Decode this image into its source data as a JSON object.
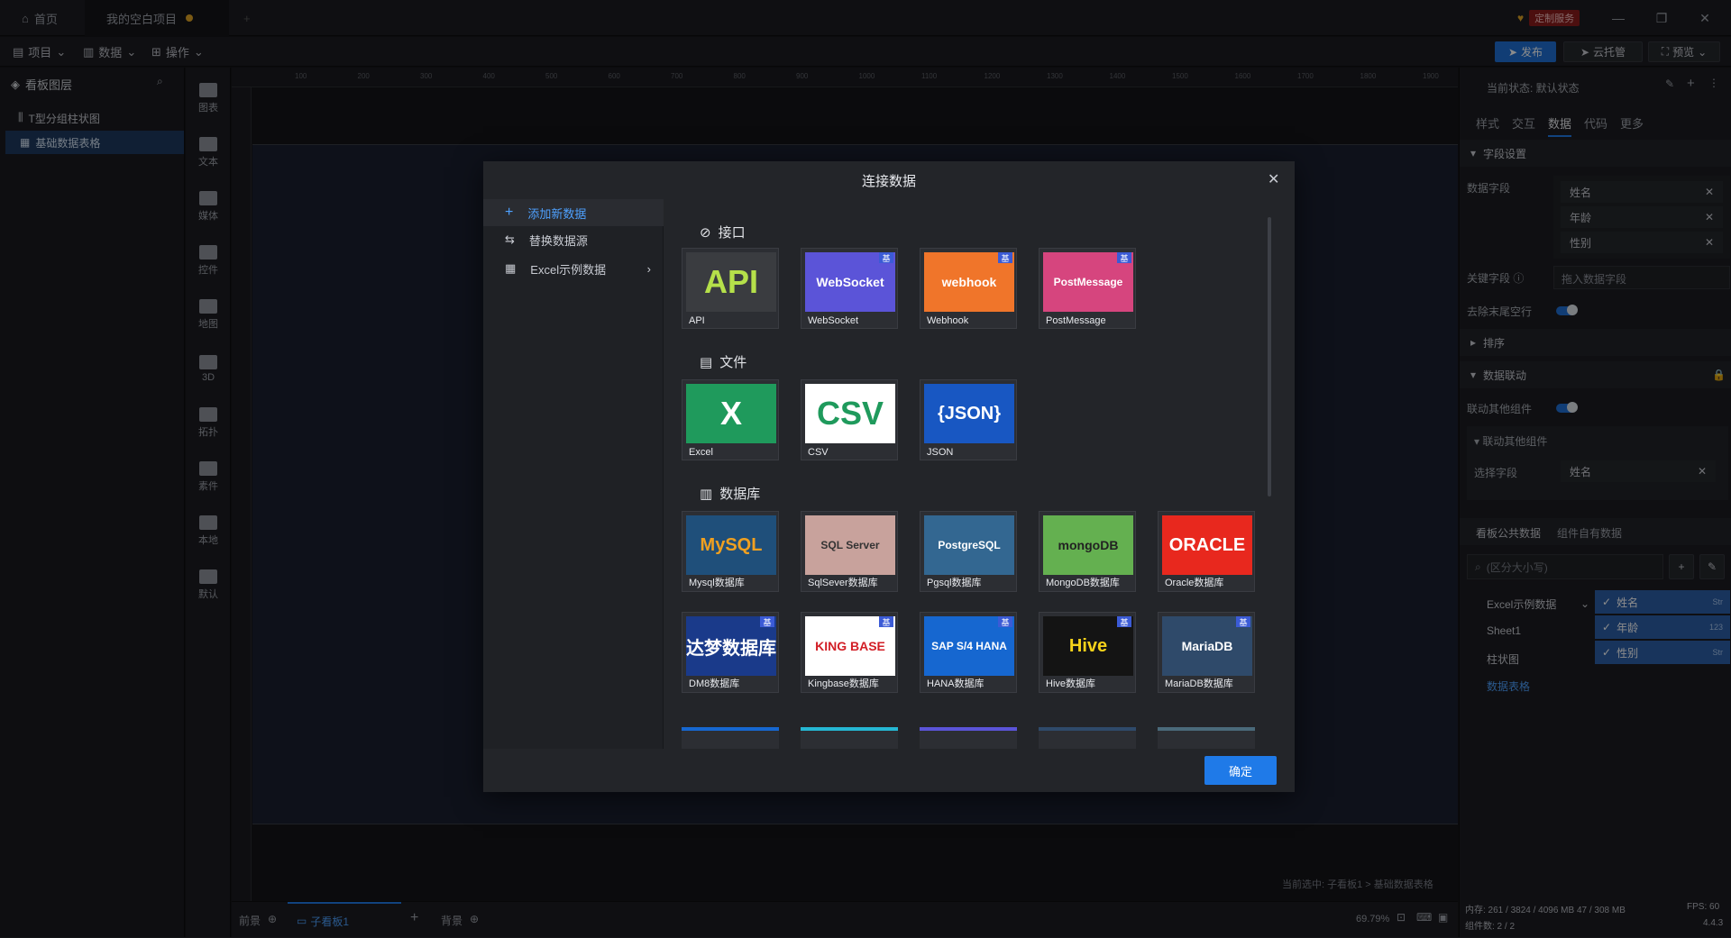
{
  "titlebar": {
    "home_tab": "首页",
    "project_tab": "我的空白项目",
    "service_label": "定制服务",
    "min_icon": "minimize-icon",
    "restore_icon": "restore-icon",
    "close_icon": "close-icon"
  },
  "menubar": {
    "items": [
      "项目",
      "数据",
      "操作"
    ],
    "publish": "发布",
    "cloud": "云托管",
    "preview": "预览"
  },
  "layers": {
    "title": "看板图层",
    "items": [
      "T型分组柱状图",
      "基础数据表格"
    ]
  },
  "toolbar": {
    "items": [
      "图表",
      "文本",
      "媒体",
      "控件",
      "地图",
      "3D",
      "拓扑",
      "素件",
      "本地",
      "默认"
    ]
  },
  "ruler": {
    "ticks": [
      "100",
      "200",
      "300",
      "400",
      "500",
      "600",
      "700",
      "800",
      "900",
      "1000",
      "1100",
      "1200",
      "1300",
      "1400",
      "1500",
      "1600",
      "1700",
      "1800",
      "1900"
    ]
  },
  "canvas": {
    "selection_text": "当前选中: 子看板1 > 基础数据表格"
  },
  "bottombar": {
    "front": "前景",
    "subboard": "子看板1",
    "bg": "背景",
    "zoom": "69.79%"
  },
  "rightpanel": {
    "state": "当前状态: 默认状态",
    "tabs": [
      "样式",
      "交互",
      "数据",
      "代码",
      "更多"
    ],
    "field_settings": "字段设置",
    "data_fields_label": "数据字段",
    "data_fields": [
      "姓名",
      "年龄",
      "性别"
    ],
    "key_field_label": "关键字段",
    "key_field_placeholder": "拖入数据字段",
    "trim_label": "去除末尾空行",
    "sort_label": "排序",
    "linkage_label": "数据联动",
    "link_other_label": "联动其他组件",
    "link_other_sub": "联动其他组件",
    "select_field_label": "选择字段",
    "select_field_value": "姓名",
    "public_data_tab": "看板公共数据",
    "own_data_tab": "组件自有数据",
    "search_placeholder": "(区分大小写)",
    "tree": [
      "Excel示例数据",
      "Sheet1",
      "柱状图",
      "数据表格"
    ],
    "fields": [
      {
        "name": "姓名",
        "type": "Str"
      },
      {
        "name": "年龄",
        "type": "123"
      },
      {
        "name": "性别",
        "type": "Str"
      }
    ],
    "memory": "内存: 261 / 3824 / 4096 MB  47 / 308 MB",
    "fps": "FPS: 60",
    "components": "组件数: 2 / 2",
    "version": "4.4.3"
  },
  "modal": {
    "title": "连接数据",
    "side": [
      "添加新数据",
      "替换数据源",
      "Excel示例数据"
    ],
    "cat_api": "接口",
    "cat_file": "文件",
    "cat_db": "数据库",
    "api_cards": [
      {
        "thumb": "API",
        "cap": "API",
        "bg": "#3a3c40",
        "fg": "#b5e04a"
      },
      {
        "thumb": "WebSocket",
        "cap": "WebSocket",
        "bg": "#5b54d8",
        "fg": "#ffffff",
        "badge": "基"
      },
      {
        "thumb": "webhook",
        "cap": "Webhook",
        "bg": "#f0752a",
        "fg": "#ffffff",
        "badge": "基"
      },
      {
        "thumb": "PostMessage",
        "cap": "PostMessage",
        "bg": "#d6457e",
        "fg": "#ffffff",
        "badge": "基"
      }
    ],
    "file_cards": [
      {
        "thumb": "X",
        "cap": "Excel",
        "bg": "#1f9a5c",
        "fg": "#ffffff"
      },
      {
        "thumb": "CSV",
        "cap": "CSV",
        "bg": "#ffffff",
        "fg": "#1f9a5c"
      },
      {
        "thumb": "{JSON}",
        "cap": "JSON",
        "bg": "#1857c2",
        "fg": "#ffffff"
      }
    ],
    "db_cards": [
      {
        "thumb": "MySQL",
        "cap": "Mysql数据库",
        "bg": "#1f4f7a",
        "fg": "#f0a020"
      },
      {
        "thumb": "SQL Server",
        "cap": "SqlSever数据库",
        "bg": "#c8a29c",
        "fg": "#333333"
      },
      {
        "thumb": "PostgreSQL",
        "cap": "Pgsql数据库",
        "bg": "#336791",
        "fg": "#ffffff"
      },
      {
        "thumb": "mongoDB",
        "cap": "MongoDB数据库",
        "bg": "#64b050",
        "fg": "#222222"
      },
      {
        "thumb": "ORACLE",
        "cap": "Oracle数据库",
        "bg": "#e8281e",
        "fg": "#ffffff"
      },
      {
        "thumb": "达梦数据库",
        "cap": "DM8数据库",
        "bg": "#1a3a8a",
        "fg": "#ffffff",
        "badge": "基"
      },
      {
        "thumb": "KING BASE",
        "cap": "Kingbase数据库",
        "bg": "#ffffff",
        "fg": "#d21e26",
        "badge": "基"
      },
      {
        "thumb": "SAP S/4 HANA",
        "cap": "HANA数据库",
        "bg": "#1667d0",
        "fg": "#ffffff",
        "badge": "基"
      },
      {
        "thumb": "Hive",
        "cap": "Hive数据库",
        "bg": "#141414",
        "fg": "#f6d21a",
        "badge": "基"
      },
      {
        "thumb": "MariaDB",
        "cap": "MariaDB数据库",
        "bg": "#2f4a6a",
        "fg": "#ffffff",
        "badge": "基"
      }
    ],
    "ok": "确定"
  }
}
